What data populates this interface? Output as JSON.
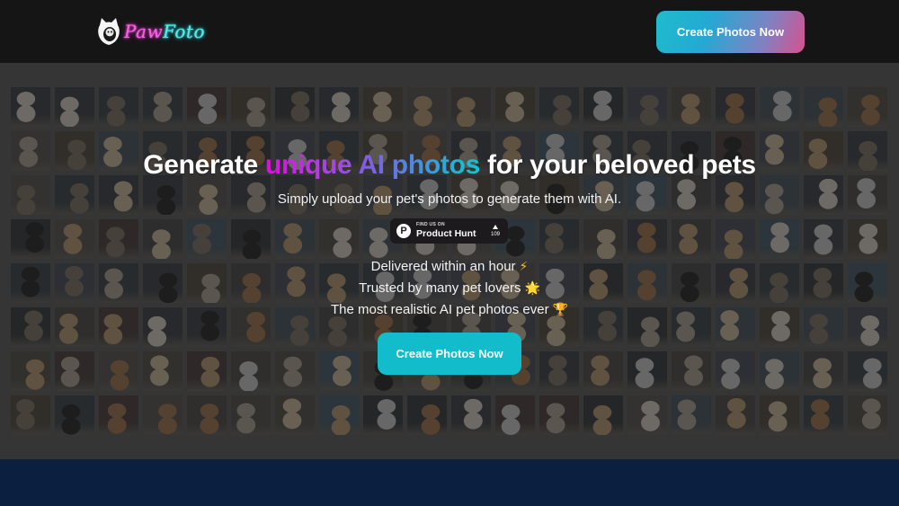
{
  "header": {
    "logo": {
      "part1": "Paw",
      "part2": "Foto",
      "icon": "cat-logo-icon"
    },
    "cta_label": "Create Photos Now"
  },
  "hero": {
    "headline": {
      "before": "Generate ",
      "highlight": "unique AI photos",
      "after": " for your beloved pets"
    },
    "subheadline": "Simply upload your pet's photos to generate them with AI.",
    "product_hunt": {
      "find_us": "FIND US ON",
      "name": "Product Hunt",
      "votes": "109",
      "icon": "product-hunt-icon"
    },
    "features": [
      {
        "text": "Delivered within an hour",
        "emoji": "⚡",
        "icon": "lightning-icon"
      },
      {
        "text": "Trusted by many pet lovers",
        "emoji": "🌟",
        "icon": "glowing-star-icon"
      },
      {
        "text": "The most realistic AI pet photos ever",
        "emoji": "🏆",
        "icon": "trophy-icon"
      }
    ],
    "cta_label": "Create Photos Now",
    "gallery": {
      "description": "Background grid of AI-generated pet photos",
      "subjects": [
        "cat",
        "dalmatian",
        "siamese cat",
        "poodle",
        "pomeranian",
        "doberman",
        "tabby cat",
        "shiba"
      ]
    }
  },
  "colors": {
    "header_bg": "#151515",
    "hero_bg": "#3b3b3b",
    "accent_cyan": "#13bccb",
    "accent_magenta": "#e00ce0",
    "accent_pink": "#d9508f",
    "footer_navy": "#0b1f40"
  }
}
